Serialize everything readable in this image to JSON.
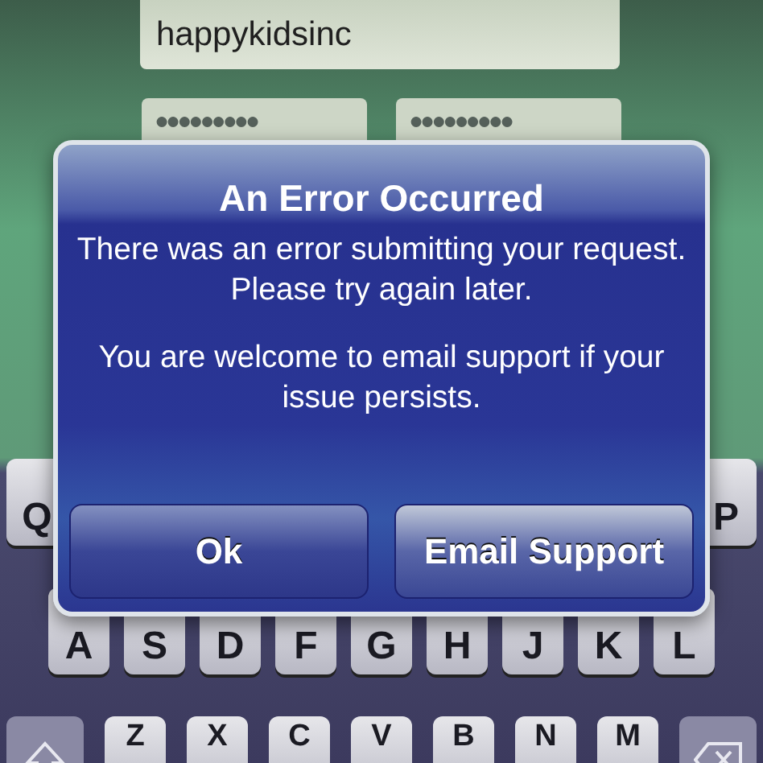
{
  "login_form": {
    "username": {
      "value": "happykidsinc"
    },
    "password_fields": [
      {
        "value": "●●●●●●●●●"
      },
      {
        "value": "●●●●●●●●●"
      }
    ]
  },
  "alert": {
    "title": "An Error Occurred",
    "message": "There was an error submitting your request. Please try again later.",
    "note": "You are welcome to email support if your issue persists.",
    "buttons": [
      {
        "label": "Ok",
        "selected": false
      },
      {
        "label": "Email Support",
        "selected": true
      }
    ]
  },
  "keyboard": {
    "top_row_keys": [
      "Q",
      "P"
    ],
    "home_row_keys": [
      "A",
      "S",
      "D",
      "F",
      "G",
      "H",
      "J",
      "K",
      "L"
    ],
    "bottom_row_keys": [
      "Z",
      "X",
      "C",
      "V",
      "B",
      "N",
      "M"
    ]
  }
}
